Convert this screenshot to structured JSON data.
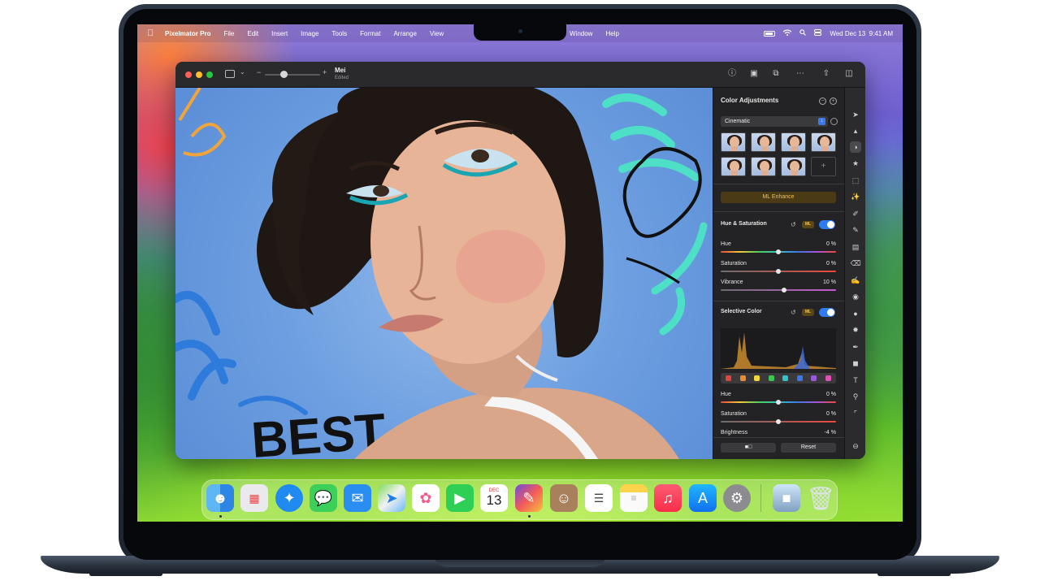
{
  "menubar": {
    "app_name": "Pixelmator Pro",
    "items": [
      "File",
      "Edit",
      "Insert",
      "Image",
      "Tools",
      "Format",
      "Arrange",
      "View"
    ],
    "items_right": [
      "Window",
      "Help"
    ],
    "date": "Wed Dec 13",
    "time": "9:41 AM"
  },
  "window": {
    "doc_title": "Mei",
    "doc_subtitle": "Edited"
  },
  "panel": {
    "title": "Color Adjustments",
    "preset": "Cinematic",
    "ml_enhance": "ML Enhance",
    "hue_saturation": {
      "title": "Hue & Saturation",
      "ml_badge": "ML",
      "sliders": [
        {
          "label": "Hue",
          "value": "0 %",
          "level": 0.5
        },
        {
          "label": "Saturation",
          "value": "0 %",
          "level": 0.5
        },
        {
          "label": "Vibrance",
          "value": "10 %",
          "level": 0.55
        }
      ]
    },
    "selective_color": {
      "title": "Selective Color",
      "ml_badge": "ML",
      "swatch_colors": [
        "#e0453b",
        "#f08a2e",
        "#f1d73a",
        "#3dc656",
        "#35c3c8",
        "#3e76e6",
        "#9b59d9",
        "#e14fb3"
      ],
      "sliders": [
        {
          "label": "Hue",
          "value": "0 %",
          "level": 0.5
        },
        {
          "label": "Saturation",
          "value": "0 %",
          "level": 0.5
        },
        {
          "label": "Brightness",
          "value": "-4 %",
          "level": 0.48
        }
      ]
    },
    "reset": "Reset"
  },
  "dock": {
    "calendar_month": "DEC",
    "calendar_day": "13",
    "apps": [
      "Finder",
      "Launchpad",
      "Safari",
      "Messages",
      "Mail",
      "Maps",
      "Photos",
      "FaceTime",
      "Calendar",
      "Pixelmator Pro",
      "Contacts",
      "Reminders",
      "Notes",
      "Music",
      "App Store",
      "System Settings"
    ]
  }
}
